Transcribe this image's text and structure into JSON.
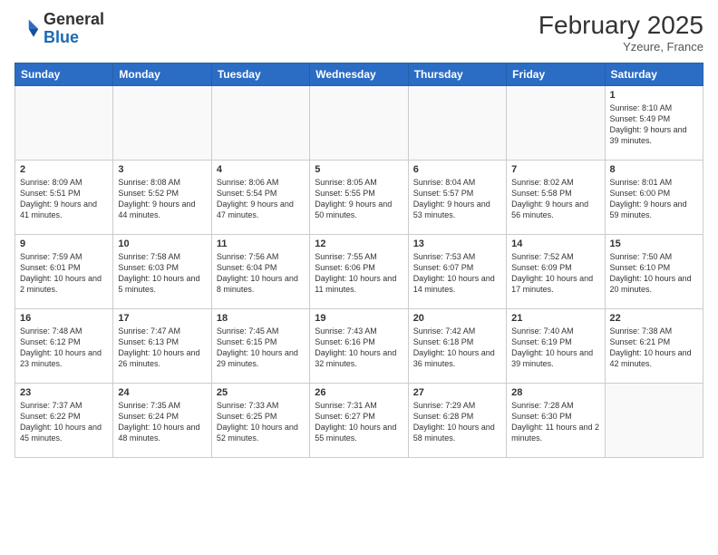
{
  "header": {
    "logo_general": "General",
    "logo_blue": "Blue",
    "month_year": "February 2025",
    "location": "Yzeure, France"
  },
  "days_of_week": [
    "Sunday",
    "Monday",
    "Tuesday",
    "Wednesday",
    "Thursday",
    "Friday",
    "Saturday"
  ],
  "weeks": [
    [
      {
        "day": "",
        "info": ""
      },
      {
        "day": "",
        "info": ""
      },
      {
        "day": "",
        "info": ""
      },
      {
        "day": "",
        "info": ""
      },
      {
        "day": "",
        "info": ""
      },
      {
        "day": "",
        "info": ""
      },
      {
        "day": "1",
        "info": "Sunrise: 8:10 AM\nSunset: 5:49 PM\nDaylight: 9 hours and 39 minutes."
      }
    ],
    [
      {
        "day": "2",
        "info": "Sunrise: 8:09 AM\nSunset: 5:51 PM\nDaylight: 9 hours and 41 minutes."
      },
      {
        "day": "3",
        "info": "Sunrise: 8:08 AM\nSunset: 5:52 PM\nDaylight: 9 hours and 44 minutes."
      },
      {
        "day": "4",
        "info": "Sunrise: 8:06 AM\nSunset: 5:54 PM\nDaylight: 9 hours and 47 minutes."
      },
      {
        "day": "5",
        "info": "Sunrise: 8:05 AM\nSunset: 5:55 PM\nDaylight: 9 hours and 50 minutes."
      },
      {
        "day": "6",
        "info": "Sunrise: 8:04 AM\nSunset: 5:57 PM\nDaylight: 9 hours and 53 minutes."
      },
      {
        "day": "7",
        "info": "Sunrise: 8:02 AM\nSunset: 5:58 PM\nDaylight: 9 hours and 56 minutes."
      },
      {
        "day": "8",
        "info": "Sunrise: 8:01 AM\nSunset: 6:00 PM\nDaylight: 9 hours and 59 minutes."
      }
    ],
    [
      {
        "day": "9",
        "info": "Sunrise: 7:59 AM\nSunset: 6:01 PM\nDaylight: 10 hours and 2 minutes."
      },
      {
        "day": "10",
        "info": "Sunrise: 7:58 AM\nSunset: 6:03 PM\nDaylight: 10 hours and 5 minutes."
      },
      {
        "day": "11",
        "info": "Sunrise: 7:56 AM\nSunset: 6:04 PM\nDaylight: 10 hours and 8 minutes."
      },
      {
        "day": "12",
        "info": "Sunrise: 7:55 AM\nSunset: 6:06 PM\nDaylight: 10 hours and 11 minutes."
      },
      {
        "day": "13",
        "info": "Sunrise: 7:53 AM\nSunset: 6:07 PM\nDaylight: 10 hours and 14 minutes."
      },
      {
        "day": "14",
        "info": "Sunrise: 7:52 AM\nSunset: 6:09 PM\nDaylight: 10 hours and 17 minutes."
      },
      {
        "day": "15",
        "info": "Sunrise: 7:50 AM\nSunset: 6:10 PM\nDaylight: 10 hours and 20 minutes."
      }
    ],
    [
      {
        "day": "16",
        "info": "Sunrise: 7:48 AM\nSunset: 6:12 PM\nDaylight: 10 hours and 23 minutes."
      },
      {
        "day": "17",
        "info": "Sunrise: 7:47 AM\nSunset: 6:13 PM\nDaylight: 10 hours and 26 minutes."
      },
      {
        "day": "18",
        "info": "Sunrise: 7:45 AM\nSunset: 6:15 PM\nDaylight: 10 hours and 29 minutes."
      },
      {
        "day": "19",
        "info": "Sunrise: 7:43 AM\nSunset: 6:16 PM\nDaylight: 10 hours and 32 minutes."
      },
      {
        "day": "20",
        "info": "Sunrise: 7:42 AM\nSunset: 6:18 PM\nDaylight: 10 hours and 36 minutes."
      },
      {
        "day": "21",
        "info": "Sunrise: 7:40 AM\nSunset: 6:19 PM\nDaylight: 10 hours and 39 minutes."
      },
      {
        "day": "22",
        "info": "Sunrise: 7:38 AM\nSunset: 6:21 PM\nDaylight: 10 hours and 42 minutes."
      }
    ],
    [
      {
        "day": "23",
        "info": "Sunrise: 7:37 AM\nSunset: 6:22 PM\nDaylight: 10 hours and 45 minutes."
      },
      {
        "day": "24",
        "info": "Sunrise: 7:35 AM\nSunset: 6:24 PM\nDaylight: 10 hours and 48 minutes."
      },
      {
        "day": "25",
        "info": "Sunrise: 7:33 AM\nSunset: 6:25 PM\nDaylight: 10 hours and 52 minutes."
      },
      {
        "day": "26",
        "info": "Sunrise: 7:31 AM\nSunset: 6:27 PM\nDaylight: 10 hours and 55 minutes."
      },
      {
        "day": "27",
        "info": "Sunrise: 7:29 AM\nSunset: 6:28 PM\nDaylight: 10 hours and 58 minutes."
      },
      {
        "day": "28",
        "info": "Sunrise: 7:28 AM\nSunset: 6:30 PM\nDaylight: 11 hours and 2 minutes."
      },
      {
        "day": "",
        "info": ""
      }
    ]
  ]
}
